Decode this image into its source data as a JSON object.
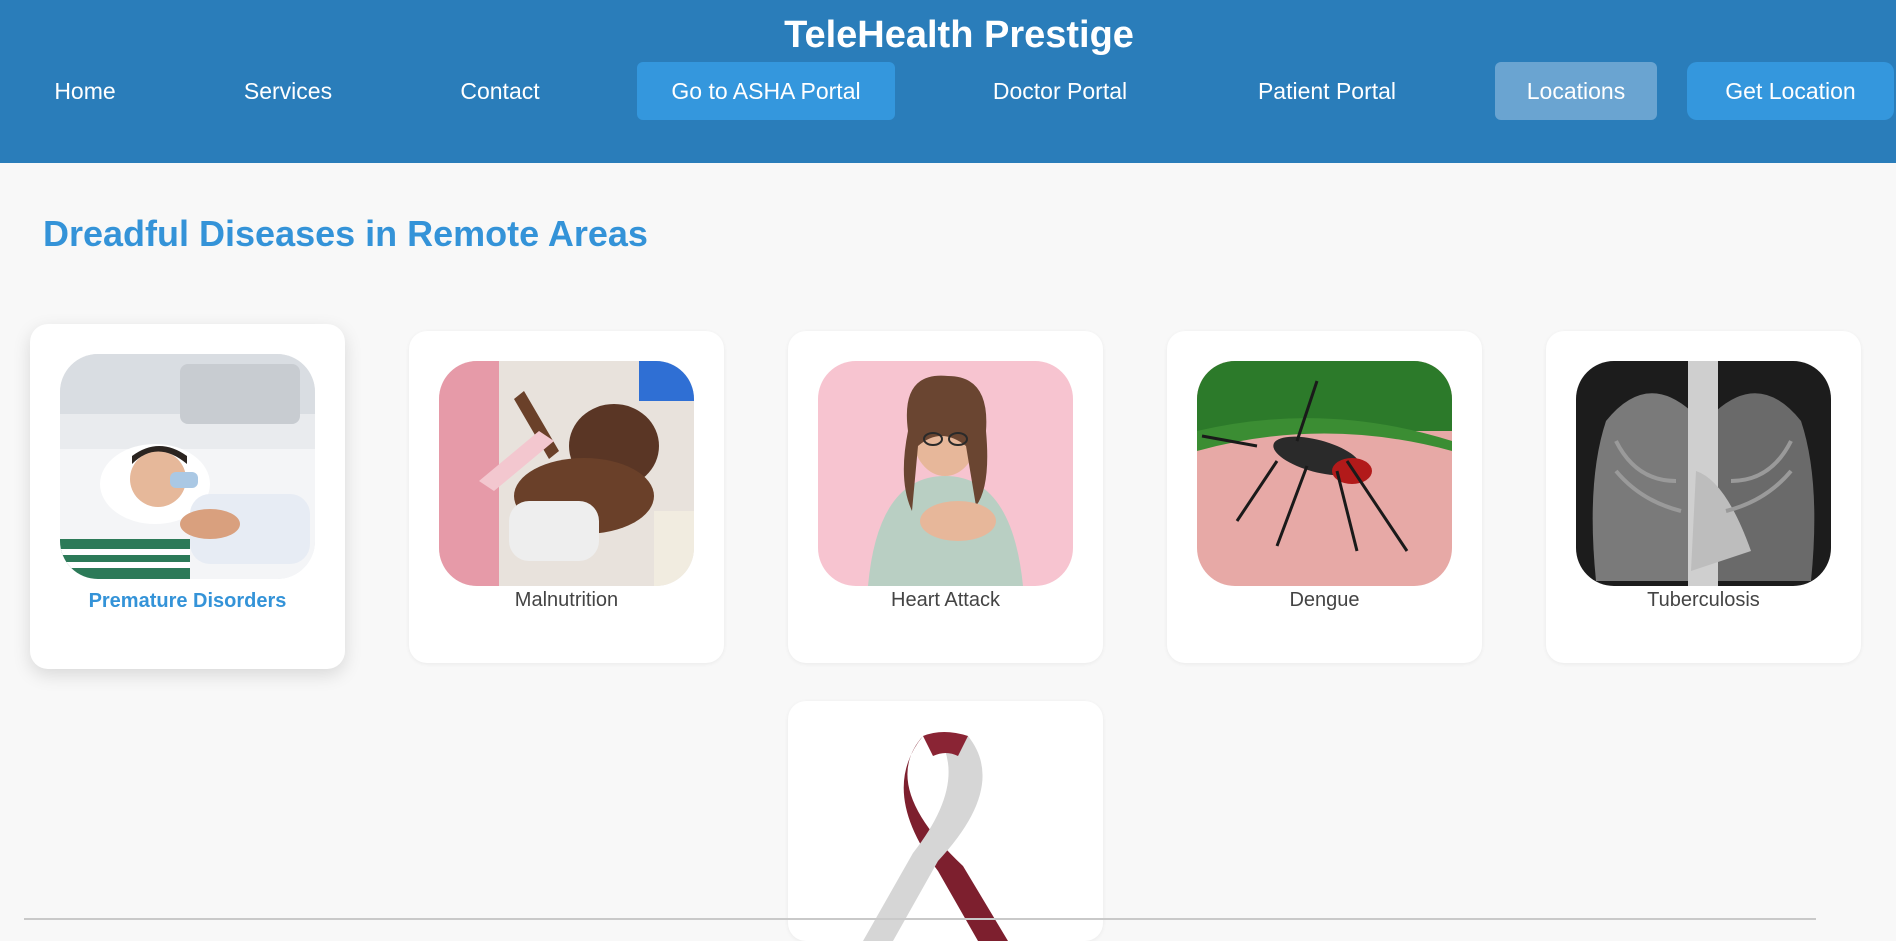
{
  "header": {
    "title": "TeleHealth Prestige",
    "nav": [
      {
        "label": "Home"
      },
      {
        "label": "Services"
      },
      {
        "label": "Contact"
      },
      {
        "label": "Go to ASHA Portal"
      },
      {
        "label": "Doctor Portal"
      },
      {
        "label": "Patient Portal"
      },
      {
        "label": "Locations"
      },
      {
        "label": "Get Location"
      }
    ]
  },
  "main": {
    "heading": "Dreadful Diseases in Remote Areas",
    "cards": [
      {
        "label": "Premature Disorders",
        "icon": "infant-hospital-photo"
      },
      {
        "label": "Malnutrition",
        "icon": "malnourished-child-photo"
      },
      {
        "label": "Heart Attack",
        "icon": "chest-pain-photo"
      },
      {
        "label": "Dengue",
        "icon": "mosquito-photo"
      },
      {
        "label": "Tuberculosis",
        "icon": "chest-xray-photo"
      },
      {
        "label": "",
        "icon": "awareness-ribbon-photo"
      }
    ]
  },
  "colors": {
    "header_bg": "#2a7dba",
    "button_bg": "#3497dd",
    "active_bg": "#6aa4d1",
    "heading": "#3493d8",
    "page_bg": "#f8f8f8"
  }
}
